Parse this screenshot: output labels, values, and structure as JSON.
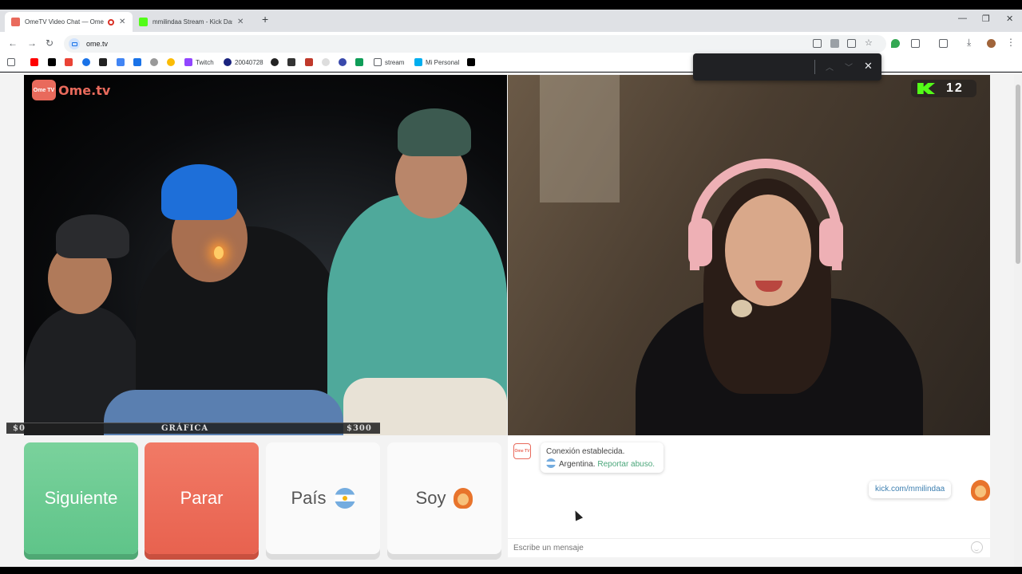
{
  "browser": {
    "tabs": [
      {
        "title": "OmeTV Video Chat — Ome",
        "active": true
      },
      {
        "title": "mmilindaa Stream - Kick Dashb",
        "active": false
      }
    ],
    "new_tab": "+",
    "url": "ome.tv",
    "bookmarks": [
      "Twitch",
      "20040728",
      "stream",
      "Mi Personal"
    ]
  },
  "video": {
    "logo_box": "Ome TV",
    "logo_word": "Ome.tv",
    "overlay": {
      "left": "$0",
      "center": "GRÁFICA",
      "right": "$300"
    },
    "kick_count": "12"
  },
  "buttons": {
    "next": "Siguiente",
    "stop": "Parar",
    "country": "País",
    "soy": "Soy"
  },
  "chat": {
    "logo": "Ome TV",
    "system_line1": "Conexión establecida.",
    "system_country": "Argentina.",
    "system_report": "Reportar abuso.",
    "my_message": "kick.com/mmilindaa",
    "input_placeholder": "Escribe un mensaje"
  },
  "colors": {
    "next": "#5fc489",
    "stop": "#e8624f",
    "brand": "#e96a5c",
    "kick": "#53fc18"
  }
}
